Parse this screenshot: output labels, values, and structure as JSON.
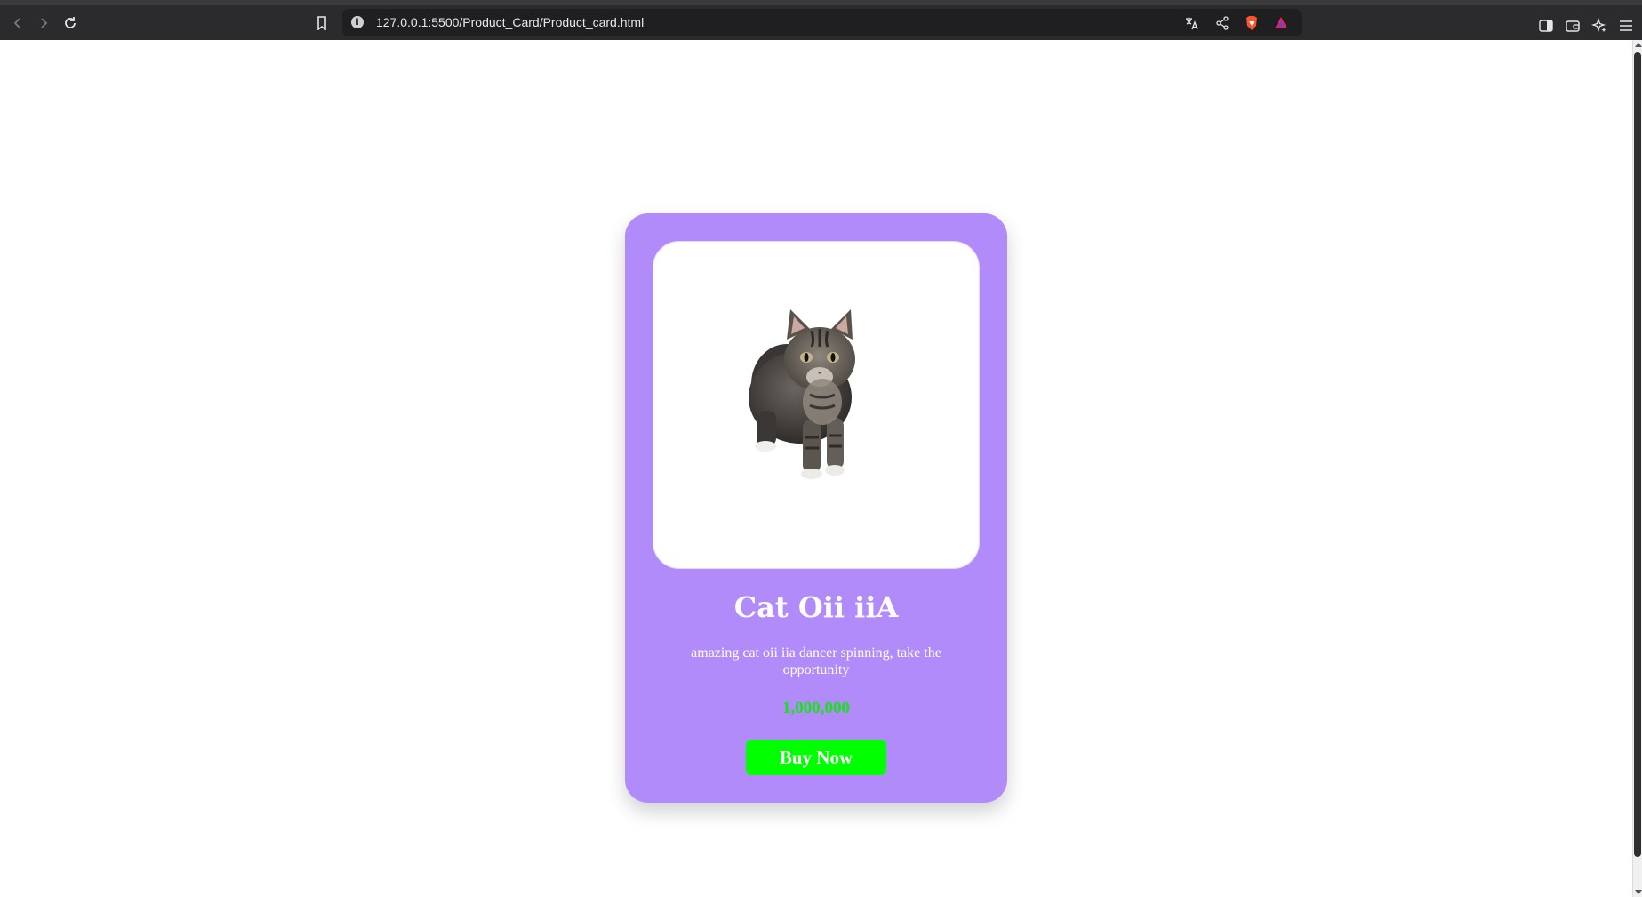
{
  "browser": {
    "url": "127.0.0.1:5500/Product_Card/Product_card.html",
    "icons": {
      "back": "back-arrow-icon",
      "forward": "forward-arrow-icon",
      "reload": "reload-icon",
      "bookmark": "bookmark-icon",
      "site_info": "info-icon",
      "translate": "translate-icon",
      "share": "share-icon",
      "brave_shields": "brave-lion-icon",
      "brave_rewards": "brave-rewards-icon",
      "sidebar": "sidebar-icon",
      "wallet": "wallet-icon",
      "leo_ai": "sparkle-icon",
      "menu": "hamburger-menu-icon"
    }
  },
  "card": {
    "title": "Cat Oii iiA",
    "description": "amazing cat oii iia dancer spinning, take the opportunity",
    "price": "1,000,000",
    "button_label": "Buy Now",
    "colors": {
      "card_background": "#b28bfb",
      "price": "#16e316",
      "button": "#00ff00"
    }
  }
}
